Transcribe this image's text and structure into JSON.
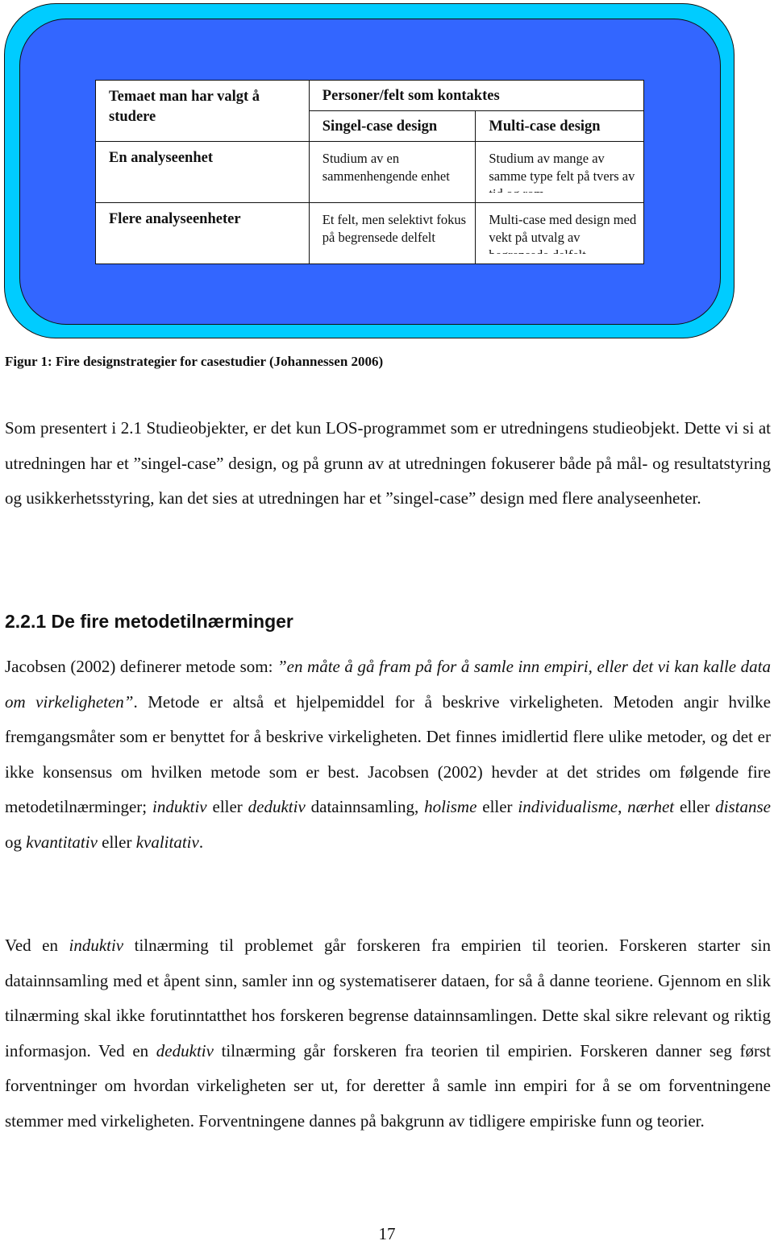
{
  "figure": {
    "colors": {
      "outer_frame": "#00ccff",
      "inner_frame": "#3366ff",
      "table_bg": "#ffffff"
    },
    "table": {
      "corner_header": "Temaet man har valgt å studere",
      "group_header": "Personer/felt som kontaktes",
      "column_headers": [
        "Singel-case design",
        "Multi-case design"
      ],
      "rows": [
        {
          "label": "En analyseenhet",
          "cells": [
            "Studium av en sammenhengende enhet",
            "Studium av mange av samme type felt på tvers av tid og rom"
          ]
        },
        {
          "label": "Flere analyseenheter",
          "cells": [
            "Et felt, men selektivt fokus på begrensede delfelt",
            "Multi-case med design med vekt på utvalg av begrensede delfelt"
          ]
        }
      ]
    },
    "caption": "Figur 1: Fire designstrategier for casestudier (Johannessen 2006)"
  },
  "paragraph1": "Som presentert i 2.1 Studieobjekter, er det kun LOS-programmet som er utredningens studieobjekt. Dette vi si at utredningen har et ”singel-case” design, og på grunn av at utredningen fokuserer både på mål- og resultatstyring og usikkerhetsstyring, kan det sies at utredningen har et ”singel-case” design med flere analyseenheter.",
  "section": {
    "heading": "2.2.1 De fire metodetilnærminger",
    "paragraph2": {
      "t1": "Jacobsen (2002) definerer metode som: ",
      "quote": "”en måte å gå fram på for å samle inn empiri, eller det vi kan kalle data om virkeligheten”",
      "t2": ". Metode er altså et hjelpemiddel for å beskrive virkeligheten. Metoden angir hvilke fremgangsmåter som er benyttet for å beskrive virkeligheten. Det finnes imidlertid flere ulike metoder, og det er ikke konsensus om hvilken metode som er best. Jacobsen (2002) hevder at det strides om følgende fire metodetilnærminger; ",
      "i1": "induktiv",
      "t3": " eller ",
      "i2": "deduktiv",
      "t4": " datainnsamling, ",
      "i3": "holisme",
      "t5": " eller ",
      "i4": "individualisme",
      "t6": ", ",
      "i5": "nærhet",
      "t7": " eller ",
      "i6": "distanse",
      "t8": " og ",
      "i7": "kvantitativ",
      "t9": " eller ",
      "i8": "kvalitativ",
      "t10": "."
    },
    "paragraph3": {
      "t1": "Ved en ",
      "i1": "induktiv",
      "t2": " tilnærming til problemet går forskeren fra empirien til teorien. Forskeren starter sin datainnsamling med et åpent sinn, samler inn og systematiserer dataen, for så å danne teoriene. Gjennom en slik tilnærming skal ikke forutinntatthet hos forskeren begrense datainnsamlingen. Dette skal sikre relevant og riktig informasjon. Ved en ",
      "i2": "deduktiv",
      "t3": " tilnærming går forskeren fra teorien til empirien. Forskeren danner seg først forventninger om hvordan virkeligheten ser ut, for deretter å samle inn empiri for å se om forventningene stemmer med virkeligheten. Forventningene dannes på bakgrunn av tidligere empiriske funn og teorier."
    }
  },
  "page_number": "17"
}
